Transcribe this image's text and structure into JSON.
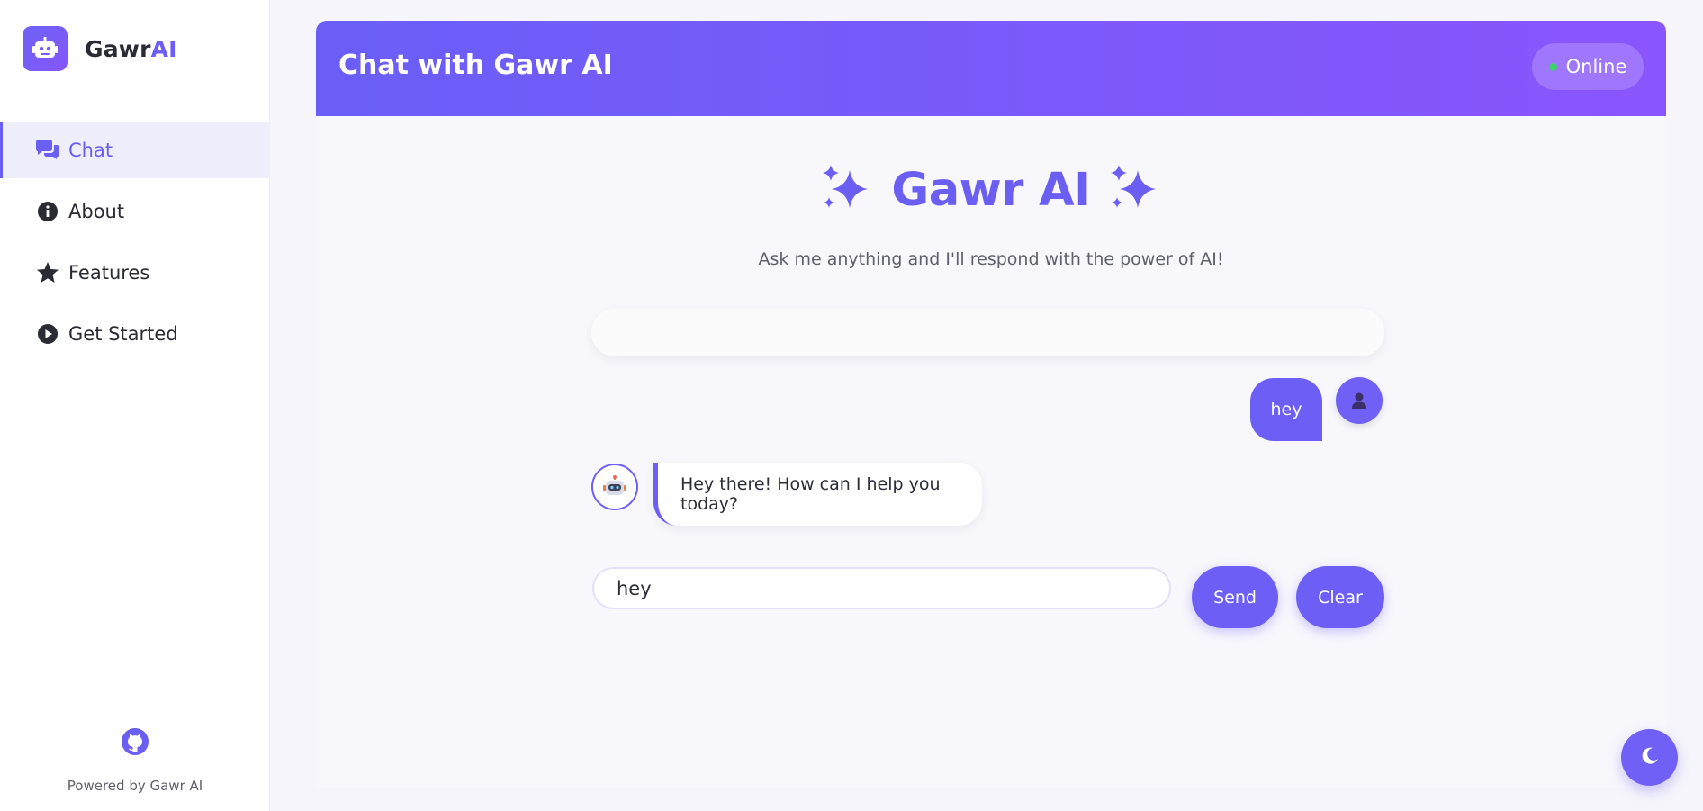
{
  "brand": {
    "name_prefix": "Gawr",
    "name_suffix": "AI"
  },
  "sidebar": {
    "items": [
      {
        "label": "Chat",
        "icon": "chat-bubbles-icon",
        "active": true
      },
      {
        "label": "About",
        "icon": "info-circle-icon",
        "active": false
      },
      {
        "label": "Features",
        "icon": "star-icon",
        "active": false
      },
      {
        "label": "Get Started",
        "icon": "play-circle-icon",
        "active": false
      }
    ],
    "footer": {
      "icon": "github-icon",
      "powered_by": "Powered by Gawr AI"
    }
  },
  "header": {
    "title": "Chat with Gawr AI",
    "status": "Online",
    "status_color": "#3ed06a"
  },
  "main": {
    "hero_title": "Gawr AI",
    "subtitle": "Ask me anything and I'll respond with the power of AI!",
    "messages": [
      {
        "role": "user",
        "text": "hey"
      },
      {
        "role": "bot",
        "text": "Hey there! How can I help you today?"
      }
    ],
    "input": {
      "value": "hey",
      "placeholder": ""
    },
    "send_label": "Send",
    "clear_label": "Clear"
  },
  "colors": {
    "accent": "#6d5ff5",
    "header_start": "#6a5ef7",
    "header_end": "#8a55fc"
  }
}
